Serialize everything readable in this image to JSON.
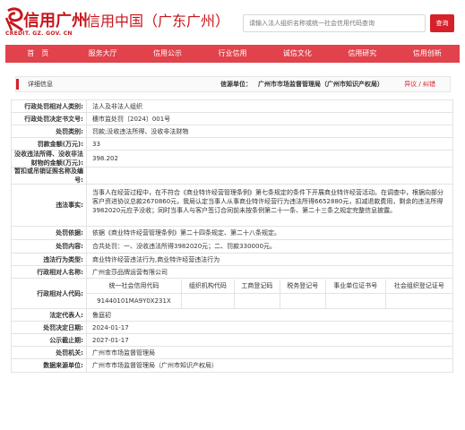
{
  "header": {
    "logo_text": "信用广州",
    "logo_sub": "CREDIT. GZ. GOV. CN",
    "site_title": "信用中国（广东广州）",
    "search_placeholder": "请输入法人组织名称或统一社会信用代码查询",
    "search_button": "查询"
  },
  "nav": {
    "items": [
      {
        "label": "首　页"
      },
      {
        "label": "服务大厅"
      },
      {
        "label": "信用公示"
      },
      {
        "label": "行业信用"
      },
      {
        "label": "诚信文化"
      },
      {
        "label": "信用研究"
      },
      {
        "label": "信用创新"
      }
    ]
  },
  "detail": {
    "title": "详细信息",
    "source_label": "信源单位：",
    "source_value": "广州市市场监督管理局（广州市知识产权局）",
    "objection": "异议 / 纠错"
  },
  "table": {
    "rows": [
      {
        "label": "行政处罚相对人类别:",
        "value": "法人及非法人组织"
      },
      {
        "label": "行政处罚决定书文号:",
        "value": "穗市监处罚〔2024〕001号"
      },
      {
        "label": "处罚类别:",
        "value": "罚款;没收违法所得、没收非法财物"
      },
      {
        "label": "罚款金额(万元):",
        "value": "33"
      },
      {
        "label": "没收违法所得、没收非法财物的金额(万元):",
        "value": "398.202"
      },
      {
        "label": "暂扣或吊销证照名称及编号:",
        "value": ""
      },
      {
        "label": "违法事实:",
        "value": "当事人在经营过程中，在不符合《商业特许经营管理条例》第七条规定的条件下开展商业特许经营活动。在调查中，根据向部分客户资进协议总款2670860元，我局认定当事人从事商业特许经营行为违法所得6652880元，扣减退款费用，剩余的违法所得3982020元应予没收；同时当事人与客户签订合同前未按条例第二十一条、第二十三条之规定完整信息披露。"
      },
      {
        "label": "处罚依据:",
        "value": "依据《商业特许经营管理条例》第二十四条规定、第二十八条规定。"
      },
      {
        "label": "处罚内容:",
        "value": "合共处罚：一、没收违法所得3982020元；二、罚款330000元。"
      },
      {
        "label": "违法行为类型:",
        "value": "商业特许经营违法行为,商业特许经营违法行为"
      },
      {
        "label": "行政相对人名称:",
        "value": "广州金莎品牌运营有限公司"
      }
    ],
    "code_row": {
      "label": "行政相对人代码:",
      "headers": [
        "统一社会信用代码",
        "组织机构代码",
        "工商登记码",
        "税务登记号",
        "事业单位证书号",
        "社会组织登记证号"
      ],
      "values": [
        "91440101MA9Y0X231X",
        "",
        "",
        "",
        "",
        ""
      ]
    },
    "tail_rows": [
      {
        "label": "法定代表人:",
        "value": "鲁庭初"
      },
      {
        "label": "处罚决定日期:",
        "value": "2024-01-17"
      },
      {
        "label": "公示截止期:",
        "value": "2027-01-17"
      },
      {
        "label": "处罚机关:",
        "value": "广州市市场监督管理局"
      },
      {
        "label": "数据来源单位:",
        "value": "广州市市场监督管理局（广州市知识产权局）"
      }
    ]
  },
  "colors": {
    "brand_red": "#c8161d",
    "nav_red": "#e1424b"
  }
}
